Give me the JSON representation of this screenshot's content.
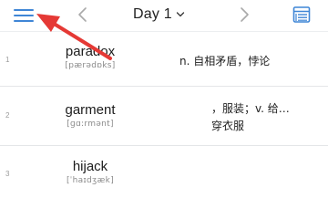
{
  "header": {
    "day_label": "Day 1",
    "accent_color": "#3f86d6",
    "icons": {
      "menu": "menu-icon",
      "prev": "chevron-left-icon",
      "next": "chevron-right-icon",
      "dropdown": "chevron-down-icon",
      "list": "list-icon"
    }
  },
  "words": [
    {
      "index": "1",
      "word": "paradox",
      "phonetic": "[pærədɒks]",
      "meaning": "n. 自相矛盾，悖论"
    },
    {
      "index": "2",
      "word": "garment",
      "phonetic": "[ɡɑ:rmənt]",
      "meaning_line1": "，服装；v. 给…",
      "meaning_line2": "穿衣服"
    },
    {
      "index": "3",
      "word": "hijack",
      "phonetic": "[ˈhaɪdʒæk]"
    }
  ],
  "annotation": {
    "arrow_color": "#e53935",
    "arrow_icon": "red-arrow-pointer"
  }
}
